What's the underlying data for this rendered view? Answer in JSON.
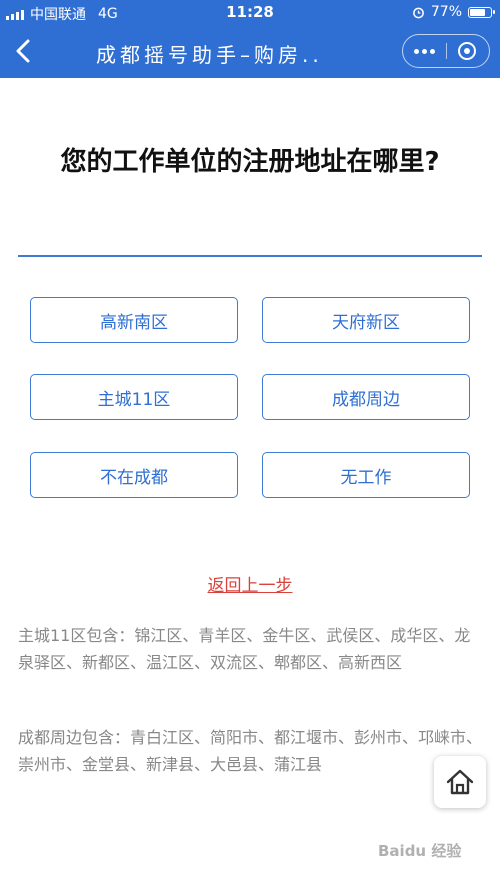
{
  "status_bar": {
    "carrier": "中国联通",
    "network": "4G",
    "time": "11:28",
    "battery": "77%",
    "battery_level": 0.77
  },
  "nav": {
    "title": "成都摇号助手–购房.."
  },
  "question": "您的工作单位的注册地址在哪里?",
  "options": [
    "高新南区",
    "天府新区",
    "主城11区",
    "成都周边",
    "不在成都",
    "无工作"
  ],
  "back_step": "返回上一步",
  "notes": [
    "主城11区包含：锦江区、青羊区、金牛区、武侯区、成华区、龙泉驿区、新都区、温江区、双流区、郫都区、高新西区",
    "成都周边包含：青白江区、简阳市、都江堰市、彭州市、邛崃市、崇州市、金堂县、新津县、大邑县、蒲江县"
  ],
  "watermark": "Baidu 经验",
  "colors": {
    "accent": "#2f6fd3",
    "link": "#d9423b"
  }
}
